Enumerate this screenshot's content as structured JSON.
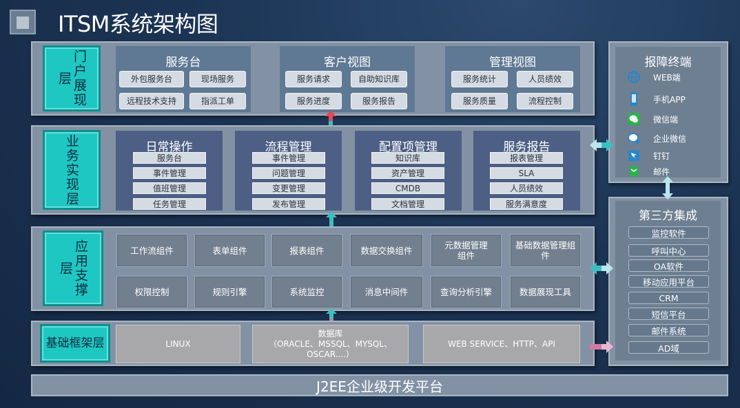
{
  "title": "ITSM系统架构图",
  "portal_layer": {
    "label": "门户展现层",
    "panels": [
      {
        "title": "服务台",
        "items": [
          "外包服务台",
          "现场服务",
          "远程技术支持",
          "指派工单"
        ]
      },
      {
        "title": "客户视图",
        "items": [
          "服务请求",
          "自助知识库",
          "服务进度",
          "服务报告"
        ]
      },
      {
        "title": "管理视图",
        "items": [
          "服务统计",
          "人员绩效",
          "服务质量",
          "流程控制"
        ]
      }
    ]
  },
  "business_layer": {
    "label": "业务实现层",
    "panels": [
      {
        "title": "日常操作",
        "items": [
          "服务台",
          "事件管理",
          "值班管理",
          "任务管理"
        ]
      },
      {
        "title": "流程管理",
        "items": [
          "事件管理",
          "问题管理",
          "变更管理",
          "发布管理"
        ]
      },
      {
        "title": "配置项管理",
        "items": [
          "知识库",
          "资产管理",
          "CMDB",
          "文档管理"
        ]
      },
      {
        "title": "服务报告",
        "items": [
          "报表管理",
          "SLA",
          "人员绩效",
          "服务满意度"
        ]
      }
    ]
  },
  "app_layer": {
    "label": "应用支撑层",
    "row1": [
      "工作流组件",
      "表单组件",
      "报表组件",
      "数据交换组件",
      "元数据管理\n组件",
      "基础数据管理组\n件"
    ],
    "row2": [
      "权限控制",
      "规则引擎",
      "系统监控",
      "消息中间件",
      "查询分析引擎",
      "数据展现工具"
    ]
  },
  "base_layer": {
    "label": "基础框架层",
    "items": [
      "LINUX",
      "数据库\n（ORACLE、MSSQL、MYSQL、\nOSCAR....）",
      "WEB SERVICE、HTTP、API"
    ]
  },
  "platform": "J2EE企业级开发平台",
  "terminals": {
    "title": "报障终端",
    "items": [
      {
        "label": "WEB端",
        "icon": "globe-icon",
        "color": "#2a86c8"
      },
      {
        "label": "手机APP",
        "icon": "phone-icon",
        "color": "#2a86c8"
      },
      {
        "label": "微信端",
        "icon": "wechat-icon",
        "color": "#2bb24c"
      },
      {
        "label": "企业微信",
        "icon": "work-wechat-icon",
        "color": "#2a86c8"
      },
      {
        "label": "钉钉",
        "icon": "dingtalk-icon",
        "color": "#2a86c8"
      },
      {
        "label": "邮件",
        "icon": "mail-icon",
        "color": "#2bb24c"
      }
    ]
  },
  "third_party": {
    "title": "第三方集成",
    "items": [
      "监控软件",
      "呼叫中心",
      "OA软件",
      "移动应用平台",
      "CRM",
      "短信平台",
      "邮件系统",
      "AD域"
    ]
  },
  "colors": {
    "layer_label": "#1fc7c3",
    "arrow_teal": "#3dbfc1",
    "arrow_red": "#e04a5a",
    "arrow_pink": "#d07aa4",
    "arrow_light": "#b9e6ec"
  }
}
